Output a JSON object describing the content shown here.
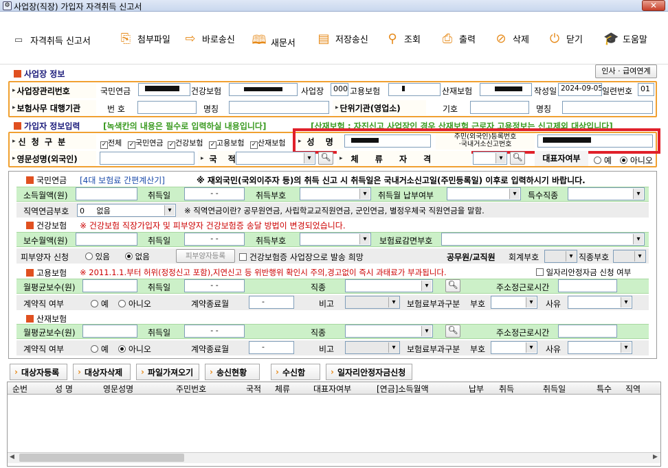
{
  "window": {
    "title": "사업장(직장) 가입자 자격취득 신고서",
    "close": "✕"
  },
  "toolbar": {
    "form_title": "자격취득 신고서",
    "items": [
      "첨부파일",
      "바로송신",
      "새문서",
      "저장송신",
      "조회",
      "출력",
      "삭제",
      "닫기",
      "도움말"
    ]
  },
  "biz": {
    "section": "사업장 정보",
    "link_btn": "인사 · 급여연계",
    "mgmt_label": "사업장관리번호",
    "pension": "국민연금",
    "health": "건강보험",
    "bizsite": "사업장",
    "bizsite_val": "000",
    "employ": "고용보험",
    "accident": "산재보험",
    "date_label": "작성일",
    "date": "2024-09-05",
    "serial_label": "일련번호",
    "serial": "01",
    "agency_label": "보험사무 대행기관",
    "agency_no": "번 호",
    "agency_name": "명칭",
    "unit_label": "단위기관(영업소)",
    "unit_code": "기호",
    "unit_name": "명칭"
  },
  "member": {
    "section": "가입자 정보입력",
    "notice_green": "[녹색칸의 내용은 필수로 입력하실 내용입니다]",
    "notice_red": "[산재보험 : 자진신고 사업장인 경우 산재보험 근로자 고용정보는 신고제외 대상입니다]",
    "apply_label": "신 청 구 분",
    "chk_all": "전체",
    "chk_items": [
      "국민연금",
      "건강보험",
      "고용보험",
      "산재보험"
    ],
    "name_label": "성 명",
    "rrn_label1": "주민(외국인)등록번호",
    "rrn_label2": "·국내거소신고번호",
    "eng_label": "영문성명(외국인)",
    "nation_label": "국 적",
    "stay_label": "체 류 자 격",
    "rep_label": "대표자여부",
    "yes": "예",
    "no": "아니오"
  },
  "pension": {
    "title": "국민연금",
    "calc_link": "[4대 보험료 간편계산기]",
    "warn": "※ 재외국민(국외이주자 등)의 취득 신고 시 취득일은 국내거소신고일(주민등록일) 이후로 입력하시기 바랍니다.",
    "income": "소득월액(원)",
    "acq_date": "취득일",
    "date_ph": "- -",
    "acq_code": "취득부호",
    "pay_month": "취득월 납부여부",
    "special": "특수직종",
    "duty_label": "직역연금부호",
    "duty_val": "0",
    "duty_text": "없음",
    "duty_note": "※ 직역연금이란? 공무원연금, 사립학교교직원연금, 군인연금, 별정우체국 직원연금을 말함."
  },
  "health": {
    "title": "건강보험",
    "warn": "※ 건강보험 직장가입자 및 피부양자 건강보험증 송달 방법이 변경되었습니다.",
    "pay": "보수월액(원)",
    "acq_date": "취득일",
    "date_ph": "- -",
    "acq_code": "취득부호",
    "reduce": "보험료감면부호",
    "dep_label": "피부양자 신청",
    "dep_yes": "있음",
    "dep_no": "없음",
    "dep_btn": "피부양자등록",
    "card_text": "건강보험증 사업장으로 발송 희망",
    "civil": "공무원/교직원",
    "acct_code": "회계부호",
    "job_code": "직종부호"
  },
  "employ": {
    "title": "고용보험",
    "warn": "※ 2011.1.1.부터 허위(정정신고 포함),지연신고 등 위반행위 확인시 주의,경고없이 즉시 과태료가 부과됩니다.",
    "subsidy": "일자리안정자금 신청 여부",
    "avg_pay": "월평균보수(원)",
    "acq_date": "취득일",
    "date_ph": "- -",
    "job": "직종",
    "hours": "주소정근로시간",
    "contract": "계약직 여부",
    "yes": "예",
    "no": "아니오",
    "end_month": "계약종료월",
    "end_ph": "-",
    "remark": "비고",
    "levy": "보험료부과구분",
    "code": "부호",
    "reason": "사유"
  },
  "accident": {
    "title": "산재보험",
    "avg_pay": "월평균보수(원)",
    "acq_date": "취득일",
    "date_ph": "- -",
    "job": "직종",
    "hours": "주소정근로시간",
    "contract": "계약직 여부",
    "yes": "예",
    "no": "아니오",
    "end_month": "계약종료월",
    "end_ph": "-",
    "remark": "비고",
    "levy": "보험료부과구분",
    "code": "부호",
    "reason": "사유"
  },
  "actions": [
    "대상자등록",
    "대상자삭제",
    "파일가져오기",
    "송신현황",
    "수신함",
    "일자리안정자금신청"
  ],
  "grid": {
    "columns": [
      "순번",
      "성 명",
      "영문성명",
      "주민번호",
      "국적",
      "체류",
      "대표자여부",
      "[연금]소득월액",
      "납부",
      "취득",
      "취득일",
      "특수",
      "직역"
    ]
  },
  "colors": {
    "accent": "#f0a030",
    "highlight": "#e0202a",
    "green": "#ccf0c8"
  }
}
